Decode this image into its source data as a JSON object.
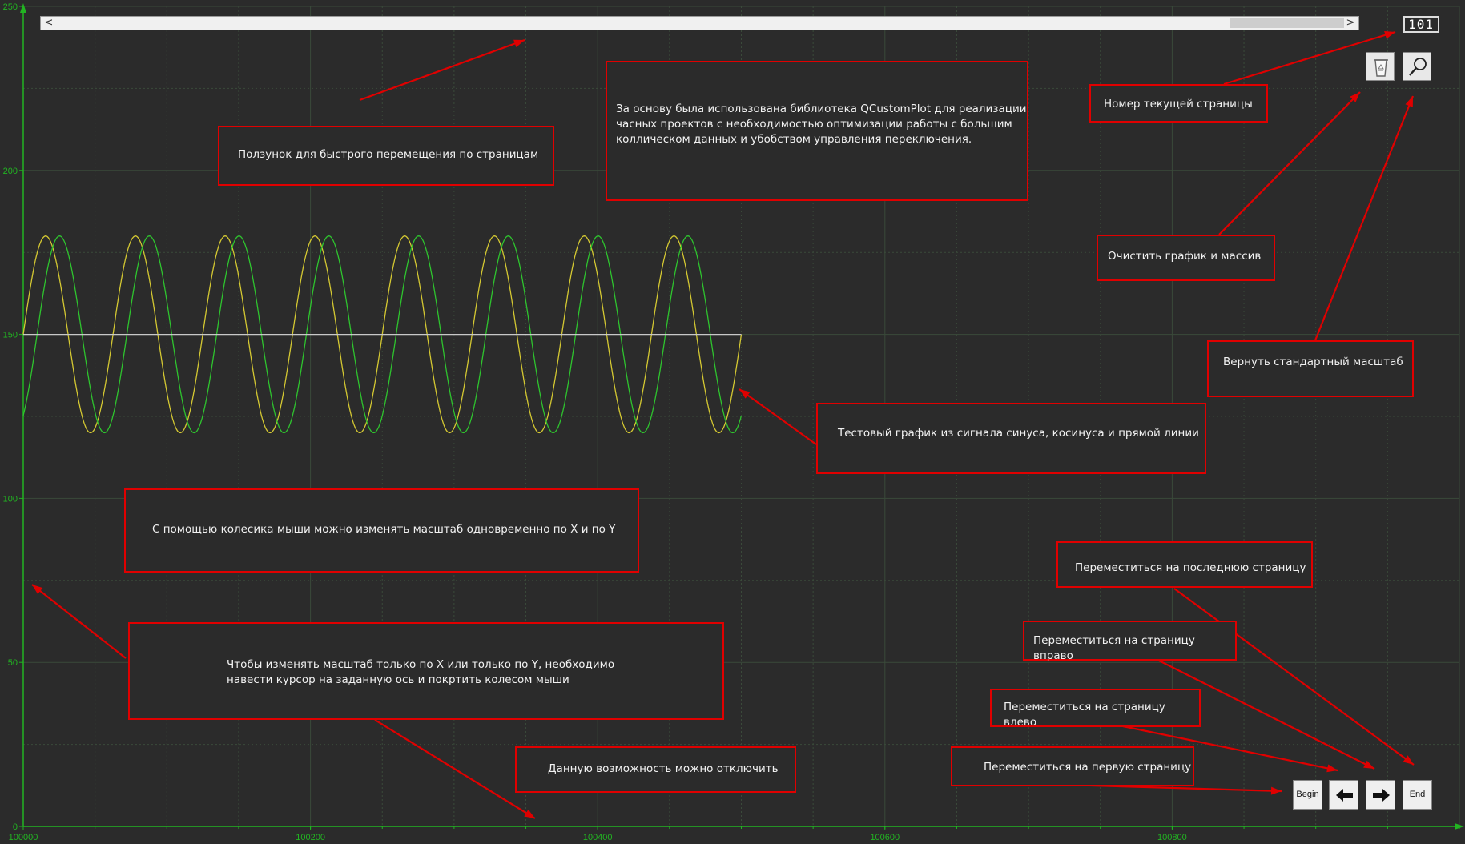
{
  "colors": {
    "background": "#2b2b2b",
    "axis": "#22b422",
    "grid": "#3a4a3a",
    "sine": "#d4c832",
    "cosine": "#2ec42e",
    "line": "#c8c8c8",
    "annotation_border": "#e00000",
    "annotation_text": "#f2f2f2"
  },
  "scrollbar": {
    "left_arrow": "<",
    "right_arrow": ">"
  },
  "page_counter": {
    "value": "101"
  },
  "toolbar": {
    "clear_icon": "trash-recycle-icon",
    "zoom_icon": "magnifier-icon"
  },
  "navigation": {
    "begin_label": "Begin",
    "prev_icon": "arrow-left-icon",
    "next_icon": "arrow-right-icon",
    "end_label": "End"
  },
  "chart_data": {
    "type": "line",
    "xlim": [
      100000,
      101000
    ],
    "ylim": [
      0,
      250
    ],
    "x_ticks": [
      "100000",
      "100200",
      "100400",
      "100600",
      "100800"
    ],
    "y_ticks": [
      "0",
      "50",
      "100",
      "150",
      "200",
      "250"
    ],
    "grid": true,
    "series": [
      {
        "color": "#d4c832",
        "kind": "sine",
        "center": 150,
        "amplitude": 30,
        "period": 62.5,
        "x_start": 100000,
        "x_end": 100500
      },
      {
        "color": "#2ec42e",
        "kind": "cosine",
        "center": 150,
        "amplitude": 30,
        "period": 62.5,
        "x_start": 100000,
        "x_end": 100500
      },
      {
        "color": "#c8c8c8",
        "kind": "constant",
        "value": 150,
        "x_start": 100000,
        "x_end": 100500
      }
    ]
  },
  "annotations": {
    "slider": "Ползунок для быстрого перемещения по страницам",
    "library": "За основу была использована библиотека QCustomPlot для реализации\nчасных проектов с необходимостью оптимизации работы с большим\nколлическом данных и убобством управления переключения.",
    "page_number": "Номер текущей страницы",
    "clear": "Очистить график и массив",
    "reset_zoom": "Вернуть стандартный масштаб",
    "test_graph": "Тестовый график из сигнала синуса, косинуса и прямой линии",
    "wheel_zoom": "С помощью колесика мыши можно изменять масштаб одновременно по X и по Y",
    "axis_zoom": "Чтобы изменять масштаб только по X или только по Y, необходимо\nнавести курсор на заданную ось и покртить колесом мыши",
    "disable": "Данную возможность можно отключить",
    "last_page": "Переместиться на последнюю страницу",
    "page_right": "Переместиться на страницу вправо",
    "page_left": "Переместиться на страницу влево",
    "first_page": "Переместиться на первую страницу"
  }
}
